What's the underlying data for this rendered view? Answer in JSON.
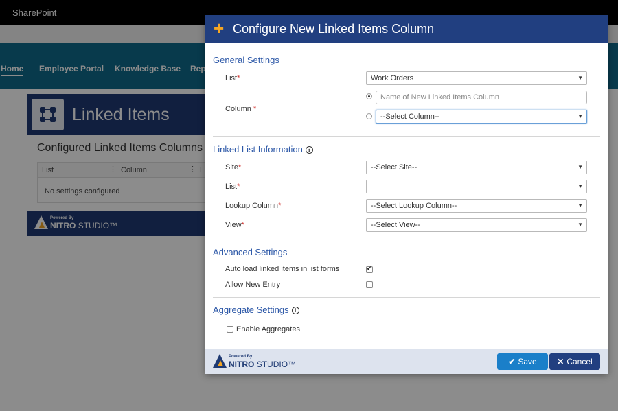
{
  "background": {
    "brand": "SharePoint",
    "nav": [
      "Home",
      "Employee Portal",
      "Knowledge Base",
      "Rep"
    ],
    "banner_title": "Linked Items",
    "configured_title": "Configured Linked Items Columns",
    "table_headers": [
      "List",
      "Column",
      "L"
    ],
    "empty_message": "No settings configured",
    "powered_by": "Powered By",
    "nitro": "NITRO",
    "studio": "STUDIO™"
  },
  "modal": {
    "title": "Configure New Linked Items Column",
    "general": {
      "title": "General Settings",
      "list_label": "List",
      "list_value": "Work Orders",
      "column_label": "Column",
      "column_placeholder": "Name of New Linked Items Column",
      "column_select": "--Select Column--"
    },
    "linked": {
      "title": "Linked List Information",
      "site_label": "Site",
      "site_value": "--Select Site--",
      "list_label": "List",
      "list_value": "",
      "lookup_label": "Lookup Column",
      "lookup_value": "--Select Lookup Column--",
      "view_label": "View",
      "view_value": "--Select View--"
    },
    "advanced": {
      "title": "Advanced Settings",
      "autoload_label": "Auto load linked items in list forms",
      "autoload_checked": true,
      "allownew_label": "Allow New Entry",
      "allownew_checked": false
    },
    "aggregate": {
      "title": "Aggregate Settings",
      "enable_label": "Enable Aggregates",
      "enable_checked": false
    },
    "footer": {
      "powered_by": "Powered By",
      "nitro": "NITRO",
      "studio": "STUDIO™",
      "save_label": "Save",
      "cancel_label": "Cancel"
    }
  },
  "colors": {
    "header": "#213f80",
    "accent": "#f5a623",
    "section": "#2e59a8",
    "save": "#1a7fc9"
  }
}
